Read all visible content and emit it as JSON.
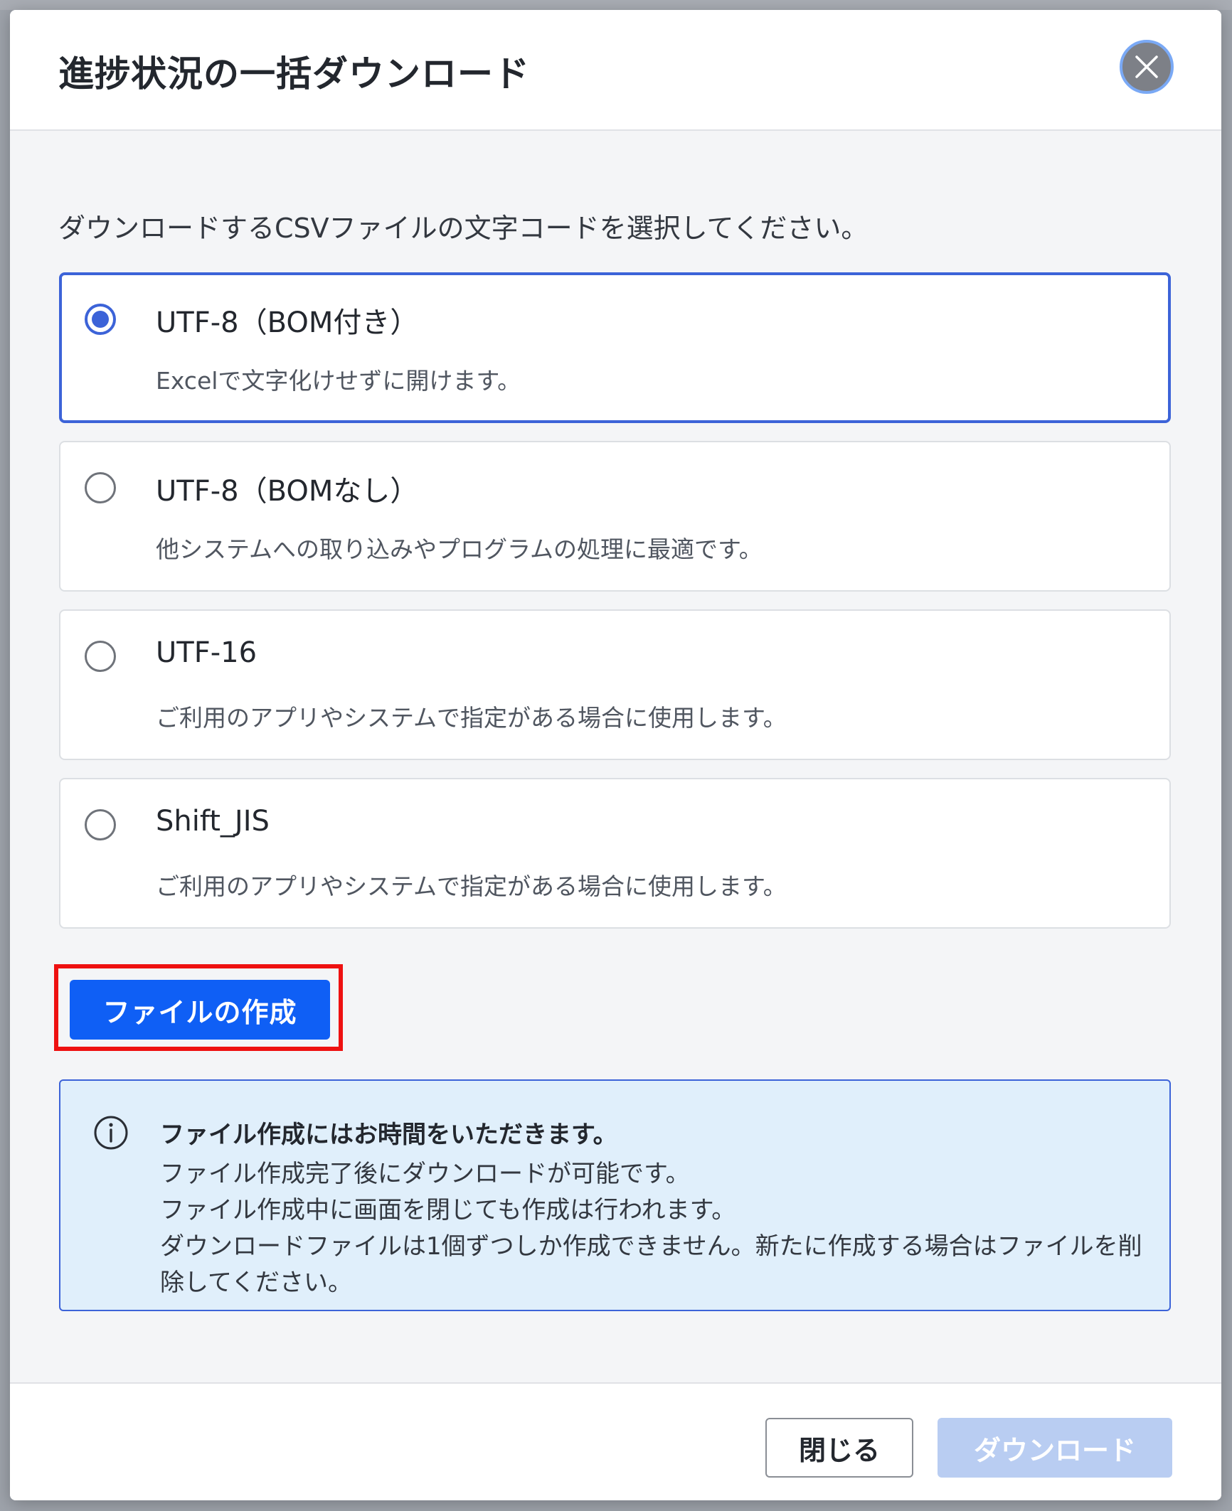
{
  "dialog": {
    "title": "進捗状況の一括ダウンロード",
    "instruction": "ダウンロードするCSVファイルの文字コードを選択してください。"
  },
  "encoding_options": [
    {
      "label": "UTF-8（BOM付き）",
      "description": "Excelで文字化けせずに開けます。",
      "selected": true
    },
    {
      "label": "UTF-8（BOMなし）",
      "description": "他システムへの取り込みやプログラムの処理に最適です。",
      "selected": false
    },
    {
      "label": "UTF-16",
      "description": "ご利用のアプリやシステムで指定がある場合に使用します。",
      "selected": false
    },
    {
      "label": "Shift_JIS",
      "description": "ご利用のアプリやシステムで指定がある場合に使用します。",
      "selected": false
    }
  ],
  "create_button": {
    "label": "ファイルの作成"
  },
  "info": {
    "title": "ファイル作成にはお時間をいただきます。",
    "lines": [
      "ファイル作成完了後にダウンロードが可能です。",
      "ファイル作成中に画面を閉じても作成は行われます。",
      "ダウンロードファイルは1個ずつしか作成できません。新たに作成する場合はファイルを削",
      "除してください。"
    ]
  },
  "footer": {
    "close_label": "閉じる",
    "download_label": "ダウンロード"
  },
  "colors": {
    "primary": "#0f5ff5",
    "selected_border": "#3c63d8",
    "highlight": "#ee1111",
    "info_bg": "#e0effb",
    "disabled_button": "#b9cdf2"
  },
  "icons": {
    "close": "close-icon",
    "info": "info-icon"
  }
}
